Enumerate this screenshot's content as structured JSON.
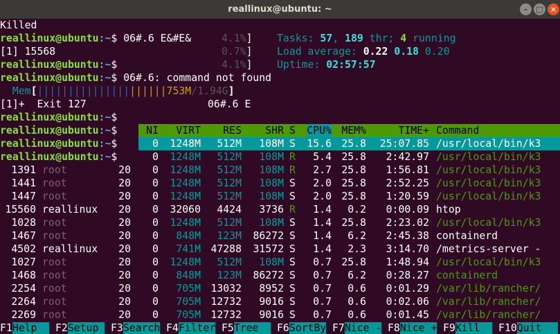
{
  "window": {
    "title": "reallinux@ubuntu: ~"
  },
  "prompt": {
    "user_host": "reallinux@ubuntu",
    "path": ":~",
    "symbol": "$"
  },
  "lines": {
    "killed": "Killed",
    "l2_cmd": " 06#.6 E&#E&",
    "l2_pct": "4.1%",
    "l3_job": "[1] 15568",
    "l3_pct": "0.7%",
    "l4_pct": "4.1%",
    "l5_msg": "06#.6: command not found",
    "mem_label": "Mem",
    "mem_bars_blue": "|||||||||||||||",
    "mem_bars_or": "||||||",
    "mem_used": "753M",
    "mem_total": "1.94G",
    "exit_line": "[1]+  Exit 127",
    "exit_cmd": "06#.6 E"
  },
  "summary": {
    "tasks_label": "Tasks:",
    "tasks": "57",
    "thr": "189",
    "thr_label": "thr;",
    "running": "4",
    "running_label": "running",
    "load_label": "Load average:",
    "load1": "0.22",
    "load5": "0.18",
    "load15": "0.20",
    "uptime_label": "Uptime:",
    "uptime": "02:57:57"
  },
  "table": {
    "columns": [
      "NI",
      "VIRT",
      "RES",
      "SHR",
      "S",
      "CPU%",
      "MEM%",
      "TIME+",
      "Command"
    ],
    "rows": [
      {
        "pid": "",
        "user": "",
        "pri": "",
        "ni": "0",
        "virt": "1248M",
        "res": "512M",
        "shr": "108M",
        "s": "S",
        "cpu": "15.6",
        "mem": "25.8",
        "time": "25:07.85",
        "cmd": "/usr/local/bin/k3"
      },
      {
        "pid": "",
        "user": "",
        "pri": "",
        "ni": "0",
        "virt": "1248M",
        "res": "512M",
        "shr": "108M",
        "s": "R",
        "cpu": "5.4",
        "mem": "25.8",
        "time": "2:42.97",
        "cmd": "/usr/local/bin/k3"
      },
      {
        "pid": "1391",
        "user": "root",
        "pri": "20",
        "ni": "0",
        "virt": "1248M",
        "res": "512M",
        "shr": "108M",
        "s": "R",
        "cpu": "2.7",
        "mem": "25.8",
        "time": "1:56.81",
        "cmd": "/usr/local/bin/k3"
      },
      {
        "pid": "1441",
        "user": "root",
        "pri": "20",
        "ni": "0",
        "virt": "1248M",
        "res": "512M",
        "shr": "108M",
        "s": "S",
        "cpu": "2.0",
        "mem": "25.8",
        "time": "2:52.25",
        "cmd": "/usr/local/bin/k3"
      },
      {
        "pid": "1447",
        "user": "root",
        "pri": "20",
        "ni": "0",
        "virt": "1248M",
        "res": "512M",
        "shr": "108M",
        "s": "S",
        "cpu": "2.0",
        "mem": "25.8",
        "time": "1:20.59",
        "cmd": "/usr/local/bin/k3"
      },
      {
        "pid": "15560",
        "user": "reallinux",
        "pri": "20",
        "ni": "0",
        "virt": "32060",
        "res": "4424",
        "shr": "3736",
        "s": "R",
        "cpu": "1.4",
        "mem": "0.2",
        "time": "0:00.09",
        "cmd": "htop"
      },
      {
        "pid": "1028",
        "user": "root",
        "pri": "20",
        "ni": "0",
        "virt": "1248M",
        "res": "512M",
        "shr": "108M",
        "s": "S",
        "cpu": "1.4",
        "mem": "25.8",
        "time": "2:23.02",
        "cmd": "/usr/local/bin/k3"
      },
      {
        "pid": "1467",
        "user": "root",
        "pri": "20",
        "ni": "0",
        "virt": "848M",
        "res": "123M",
        "shr": "86272",
        "s": "S",
        "cpu": "1.4",
        "mem": "6.2",
        "time": "2:45.38",
        "cmd": "containerd"
      },
      {
        "pid": "4502",
        "user": "reallinux",
        "pri": "20",
        "ni": "0",
        "virt": "741M",
        "res": "47288",
        "shr": "31572",
        "s": "S",
        "cpu": "1.4",
        "mem": "2.3",
        "time": "3:14.70",
        "cmd": "/metrics-server -"
      },
      {
        "pid": "1027",
        "user": "root",
        "pri": "20",
        "ni": "0",
        "virt": "1248M",
        "res": "512M",
        "shr": "108M",
        "s": "S",
        "cpu": "0.7",
        "mem": "25.8",
        "time": "1:48.94",
        "cmd": "/usr/local/bin/k3"
      },
      {
        "pid": "1468",
        "user": "root",
        "pri": "20",
        "ni": "0",
        "virt": "848M",
        "res": "123M",
        "shr": "86272",
        "s": "S",
        "cpu": "0.7",
        "mem": "6.2",
        "time": "0:28.27",
        "cmd": "containerd"
      },
      {
        "pid": "2254",
        "user": "root",
        "pri": "20",
        "ni": "0",
        "virt": "705M",
        "res": "13032",
        "shr": "8952",
        "s": "S",
        "cpu": "0.7",
        "mem": "0.6",
        "time": "0:01.29",
        "cmd": "/var/lib/rancher/"
      },
      {
        "pid": "2264",
        "user": "root",
        "pri": "20",
        "ni": "0",
        "virt": "705M",
        "res": "12732",
        "shr": "9016",
        "s": "S",
        "cpu": "0.7",
        "mem": "0.6",
        "time": "0:02.06",
        "cmd": "/var/lib/rancher/"
      },
      {
        "pid": "2269",
        "user": "root",
        "pri": "20",
        "ni": "0",
        "virt": "705M",
        "res": "12732",
        "shr": "9016",
        "s": "S",
        "cpu": "0.7",
        "mem": "0.6",
        "time": "0:01.45",
        "cmd": "/var/lib/rancher/"
      }
    ]
  },
  "fkeys": [
    {
      "key": "F1",
      "label": "Help  "
    },
    {
      "key": "F2",
      "label": "Setup "
    },
    {
      "key": "F3",
      "label": "Search"
    },
    {
      "key": "F4",
      "label": "Filter"
    },
    {
      "key": "F5",
      "label": "Tree  "
    },
    {
      "key": "F6",
      "label": "SortBy"
    },
    {
      "key": "F7",
      "label": "Nice -"
    },
    {
      "key": "F8",
      "label": "Nice +"
    },
    {
      "key": "F9",
      "label": "Kill  "
    },
    {
      "key": "F10",
      "label": "Quit"
    }
  ],
  "colors": {
    "bg": "#300a24",
    "green": "#4e9a06",
    "cyan": "#06989a",
    "prompt_green": "#8ae234",
    "prompt_blue": "#729fcf"
  }
}
